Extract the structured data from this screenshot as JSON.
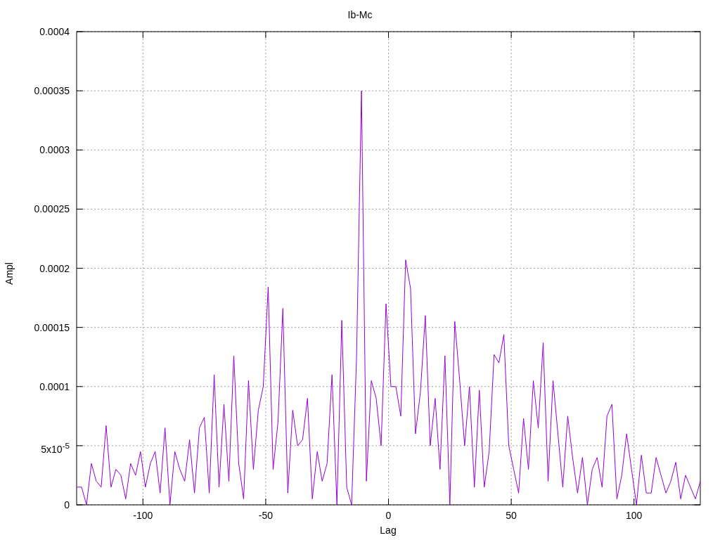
{
  "chart_data": {
    "type": "line",
    "title": "Ib-Mc",
    "xlabel": "Lag",
    "ylabel": "Ampl",
    "grid": true,
    "xlim": [
      -127,
      127
    ],
    "ylim": [
      0,
      0.0004
    ],
    "xticks": [
      -100,
      -50,
      0,
      50,
      100
    ],
    "yticks": [
      0,
      {
        "value": 5e-05,
        "label": "5x10$^{-5}$"
      },
      0.0001,
      0.00015,
      0.0002,
      0.00025,
      0.0003,
      0.00035,
      0.0004
    ],
    "x": [
      -127,
      -125,
      -123,
      -121,
      -119,
      -117,
      -115,
      -113,
      -111,
      -109,
      -107,
      -105,
      -103,
      -101,
      -99,
      -97,
      -95,
      -93,
      -91,
      -89,
      -87,
      -85,
      -83,
      -81,
      -79,
      -77,
      -75,
      -73,
      -71,
      -69,
      -67,
      -65,
      -63,
      -61,
      -59,
      -57,
      -55,
      -53,
      -51,
      -49,
      -47,
      -45,
      -43,
      -41,
      -39,
      -37,
      -35,
      -33,
      -31,
      -29,
      -27,
      -25,
      -23,
      -21,
      -19,
      -17,
      -15,
      -13,
      -11,
      -9,
      -7,
      -5,
      -3,
      -1,
      1,
      3,
      5,
      7,
      9,
      11,
      13,
      15,
      17,
      19,
      21,
      23,
      25,
      27,
      29,
      31,
      33,
      35,
      37,
      39,
      41,
      43,
      45,
      47,
      49,
      51,
      53,
      55,
      57,
      59,
      61,
      63,
      65,
      67,
      69,
      71,
      73,
      75,
      77,
      79,
      81,
      83,
      85,
      87,
      89,
      91,
      93,
      95,
      97,
      99,
      101,
      103,
      105,
      107,
      109,
      111,
      113,
      115,
      117,
      119,
      121,
      123,
      125,
      127
    ],
    "series": [
      {
        "color": "#9400d3",
        "values": [
          1.5e-05,
          1.5e-05,
          0,
          3.5e-05,
          2e-05,
          1.5e-05,
          6.7e-05,
          1.5e-05,
          3e-05,
          2.5e-05,
          5e-06,
          3.5e-05,
          2.5e-05,
          4.5e-05,
          1.5e-05,
          3.5e-05,
          4.5e-05,
          1e-05,
          6.5e-05,
          0,
          4.5e-05,
          3e-05,
          2e-05,
          5.5e-05,
          1e-05,
          6.5e-05,
          7.4e-05,
          1e-05,
          0.00011,
          1.5e-05,
          8.5e-05,
          2e-05,
          0.000126,
          3.5e-05,
          5e-06,
          0.000105,
          3e-05,
          8e-05,
          0.0001,
          0.000184,
          3e-05,
          7e-05,
          0.000166,
          1e-05,
          8e-05,
          5e-05,
          5.5e-05,
          9e-05,
          5e-06,
          4.5e-05,
          2e-05,
          3.5e-05,
          0.00011,
          0,
          0.000156,
          1.5e-05,
          0,
          0.000125,
          0.00035,
          2e-05,
          0.000105,
          9e-05,
          5e-05,
          0.00017,
          0.0001,
          0.0001,
          7.5e-05,
          0.000207,
          0.000183,
          6e-05,
          9.5e-05,
          0.00016,
          5e-05,
          9e-05,
          3e-05,
          0.000126,
          0,
          0.000155,
          0.000105,
          5e-05,
          0.0001,
          1.5e-05,
          9.7e-05,
          1.5e-05,
          4.5e-05,
          0.000127,
          0.00012,
          0.000144,
          5e-05,
          3e-05,
          1e-05,
          7.3e-05,
          3e-05,
          0.000105,
          6.5e-05,
          0.000137,
          2e-05,
          0.000105,
          6e-05,
          1.5e-05,
          7.5e-05,
          4e-05,
          1e-05,
          4e-05,
          0,
          3e-05,
          4e-05,
          1.5e-05,
          7.5e-05,
          8.5e-05,
          5e-06,
          2.5e-05,
          6e-05,
          3e-05,
          0,
          4.2e-05,
          1e-05,
          1e-05,
          4e-05,
          2.5e-05,
          1e-05,
          2e-05,
          3.6e-05,
          5e-06,
          2.5e-05,
          1.5e-05,
          5e-06,
          2e-05
        ]
      }
    ]
  }
}
